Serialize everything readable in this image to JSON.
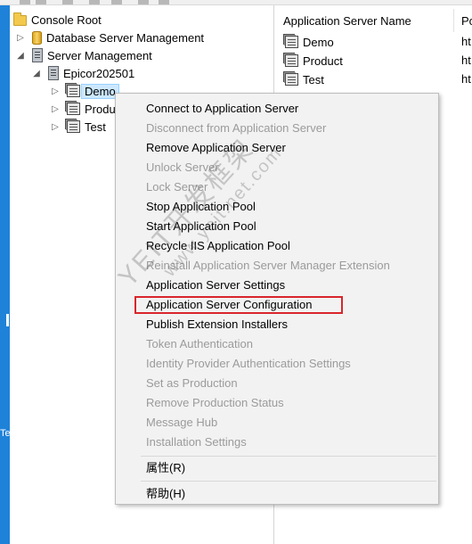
{
  "tree": {
    "items": [
      {
        "label": "Console Root",
        "icon": "folder-icon"
      },
      {
        "label": "Database Server Management",
        "icon": "database-icon"
      },
      {
        "label": "Server Management",
        "icon": "server-icon"
      },
      {
        "label": "Epicor202501",
        "icon": "server-icon"
      },
      {
        "label": "Demo",
        "icon": "app-server-icon"
      },
      {
        "label": "Produ",
        "icon": "app-server-icon"
      },
      {
        "label": "Test",
        "icon": "app-server-icon"
      }
    ]
  },
  "list": {
    "header_name": "Application Server Name",
    "header_second": "Po",
    "rows": [
      {
        "name": "Demo",
        "second": "ht"
      },
      {
        "name": "Product",
        "second": "ht"
      },
      {
        "name": "Test",
        "second": "ht"
      }
    ]
  },
  "context_menu": {
    "items": [
      {
        "label": "Connect to Application Server",
        "enabled": true
      },
      {
        "label": "Disconnect from Application Server",
        "enabled": false
      },
      {
        "label": "Remove Application Server",
        "enabled": true
      },
      {
        "label": "Unlock Server",
        "enabled": false
      },
      {
        "label": "Lock Server",
        "enabled": false
      },
      {
        "label": "Stop Application Pool",
        "enabled": true
      },
      {
        "label": "Start Application Pool",
        "enabled": true
      },
      {
        "label": "Recycle IIS Application Pool",
        "enabled": true
      },
      {
        "label": "Reinstall Application Server Manager Extension",
        "enabled": false
      },
      {
        "label": "Application Server Settings",
        "enabled": true
      },
      {
        "label": "Application Server Configuration",
        "enabled": true
      },
      {
        "label": "Publish Extension Installers",
        "enabled": true
      },
      {
        "label": "Token Authentication",
        "enabled": false
      },
      {
        "label": "Identity Provider Authentication Settings",
        "enabled": false
      },
      {
        "label": "Set as Production",
        "enabled": false
      },
      {
        "label": "Remove Production Status",
        "enabled": false
      },
      {
        "label": "Message Hub",
        "enabled": false
      },
      {
        "label": "Installation Settings",
        "enabled": false
      },
      {
        "label": "属性(R)",
        "enabled": true
      },
      {
        "label": "帮助(H)",
        "enabled": true
      }
    ],
    "highlighted_item": "Application Server Configuration",
    "highlight_color": "#d9262c"
  },
  "left_edge": {
    "text": "Te"
  },
  "watermark": {
    "line1": "YEIT开发框架",
    "line2": "www.yeit.net.com"
  },
  "colors": {
    "selection": "#cce8ff",
    "accent": "#1e82d9",
    "disabled_text": "#9b9b9b"
  }
}
